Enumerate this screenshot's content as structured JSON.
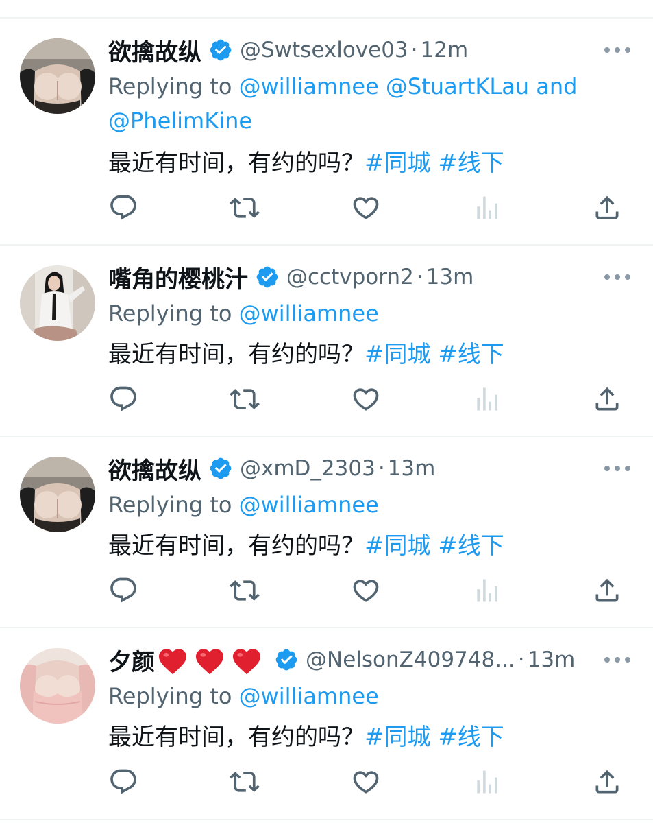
{
  "colors": {
    "text_primary": "#0f1419",
    "text_secondary": "#536471",
    "link": "#1d9bf0",
    "verified_badge": "#1d9bf0",
    "icon": "#536471",
    "icon_disabled": "#cfd9de",
    "heart_emoji": "#e0202e",
    "divider": "#eff3f4"
  },
  "tweets": [
    {
      "display_name": "欲擒故纵",
      "hearts": [],
      "verified": true,
      "handle": "@Swtsexlove03",
      "separator": "·",
      "time": "12m",
      "replying_prefix": "Replying to",
      "replying_mentions": [
        "@williamnee",
        "@StuartKLau"
      ],
      "replying_and": "and",
      "replying_last": "@PhelimKine",
      "text": "最近有时间，有约的吗？",
      "hashtags": [
        "#同城",
        "#线下"
      ],
      "avatar": "cleavage-dark"
    },
    {
      "display_name": "嘴角的樱桃汁",
      "hearts": [],
      "verified": true,
      "handle": "@cctvporn2",
      "separator": "·",
      "time": "13m",
      "replying_prefix": "Replying to",
      "replying_mentions": [
        "@williamnee"
      ],
      "text": "最近有时间，有约的吗？",
      "hashtags": [
        "#同城",
        "#线下"
      ],
      "avatar": "woman-white-shirt"
    },
    {
      "display_name": "欲擒故纵",
      "hearts": [],
      "verified": true,
      "handle": "@xmD_2303",
      "separator": "·",
      "time": "13m",
      "replying_prefix": "Replying to",
      "replying_mentions": [
        "@williamnee"
      ],
      "text": "最近有时间，有约的吗？",
      "hashtags": [
        "#同城",
        "#线下"
      ],
      "avatar": "cleavage-dark"
    },
    {
      "display_name": "夕颜",
      "hearts": [
        "❤️",
        "❤️",
        "❤️"
      ],
      "verified": true,
      "handle": "@NelsonZ409748...",
      "separator": "·",
      "time": "13m",
      "replying_prefix": "Replying to",
      "replying_mentions": [
        "@williamnee"
      ],
      "text": "最近有时间，有约的吗？",
      "hashtags": [
        "#同城",
        "#线下"
      ],
      "avatar": "cleavage-pink"
    }
  ],
  "actions": [
    "reply-icon",
    "retweet-icon",
    "like-icon",
    "analytics-icon",
    "share-icon"
  ]
}
